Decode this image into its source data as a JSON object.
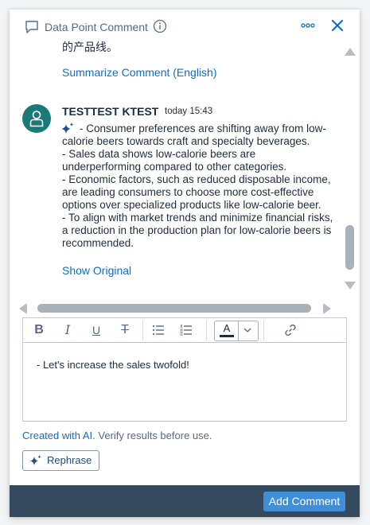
{
  "header": {
    "title": "Data Point Comment"
  },
  "thread": {
    "partial_previous_text": "的产品线。",
    "summarize_label": "Summarize Comment (English)",
    "comment": {
      "author": "TESTTEST KTEST",
      "timestamp": "today 15:43",
      "lines": [
        "- Consumer preferences are shifting away from low-",
        "calorie beers towards craft and specialty beverages.",
        "- Sales data shows low-calorie beers are",
        "underperforming compared to other categories.",
        "- Economic factors, such as reduced disposable income,",
        "are leading consumers to choose more cost-effective",
        "options over specialized products like low-calorie beer.",
        "- To align with market trends and minimize financial risks,",
        "a reduction in the production plan for low-calorie beers is",
        "recommended."
      ],
      "show_original_label": "Show Original"
    }
  },
  "toolbar": {
    "bold": "B",
    "italic": "I",
    "underline": "U",
    "strikethrough": "T",
    "text_color": "A"
  },
  "editor": {
    "value": "- Let's increase the sales twofold!"
  },
  "disclaimer": {
    "ai_link": "Created with AI.",
    "verify_text": "Verify results before use."
  },
  "rephrase_label": "Rephrase",
  "add_comment_label": "Add Comment",
  "colors": {
    "link": "#0a6ed1",
    "avatar": "#1a7a7a",
    "footer": "#354a5f",
    "primary_button": "#3f8fd8"
  }
}
